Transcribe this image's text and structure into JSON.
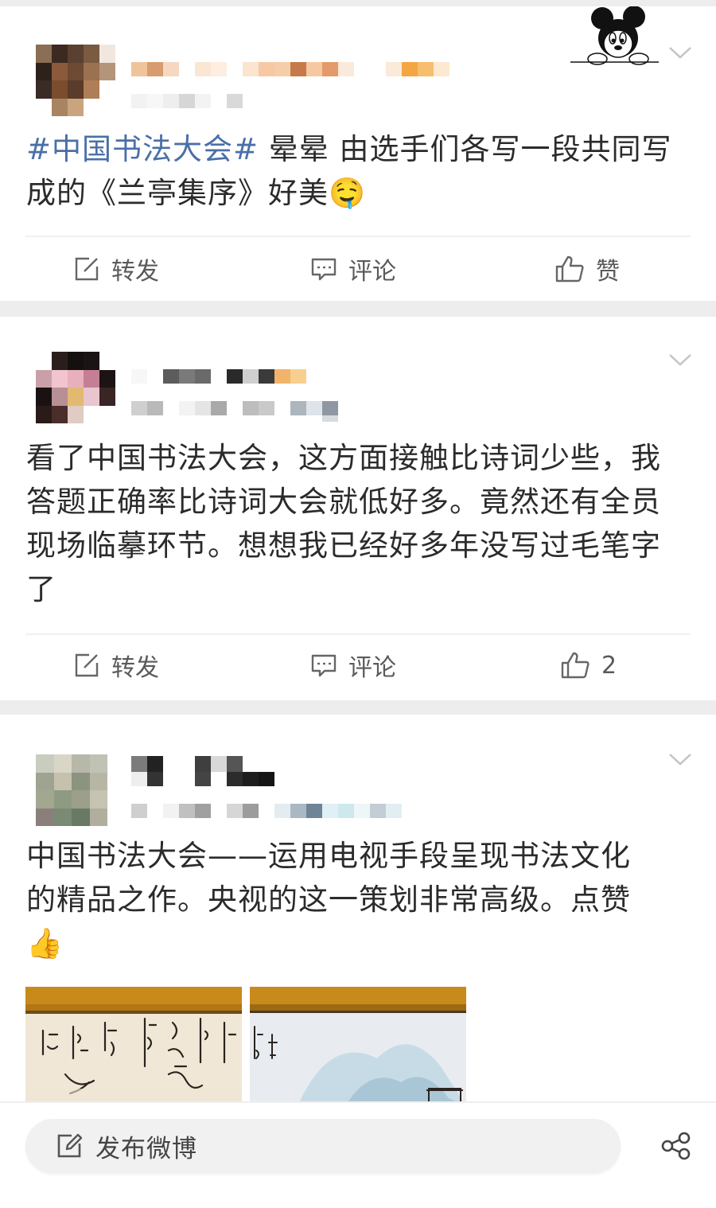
{
  "posts": [
    {
      "text_hashtag": "#中国书法大会#",
      "text_line1_rest": " 晕晕 由选手们各写一段共同写",
      "text_line2": "成的《兰亭集序》好美",
      "emoji": "🤤",
      "actions": {
        "repost": "转发",
        "comment": "评论",
        "like": "赞"
      }
    },
    {
      "text_lines": [
        "看了中国书法大会，这方面接触比诗词少些，我",
        "答题正确率比诗词大会就低好多。竟然还有全员",
        "现场临摹环节。想想我已经好多年没写过毛笔字",
        "了"
      ],
      "actions": {
        "repost": "转发",
        "comment": "评论",
        "like": "2"
      }
    },
    {
      "text_lines": [
        "中国书法大会——运用电视手段呈现书法文化",
        "的精品之作。央视的这一策划非常高级。点赞"
      ],
      "emoji": "👍"
    }
  ],
  "bottom_bar": {
    "compose_label": "发布微博"
  },
  "icons": {
    "repost": "edit-square-icon",
    "comment": "comment-bubble-icon",
    "like": "thumbs-up-icon",
    "more": "chevron-down-icon",
    "share": "share-icon",
    "compose": "compose-icon",
    "sticker": "mickey-sticker"
  },
  "colors": {
    "hashtag": "#4a6fa8",
    "text": "#2b2b2b",
    "action_text": "#5a5a5a",
    "background": "#ededed"
  }
}
